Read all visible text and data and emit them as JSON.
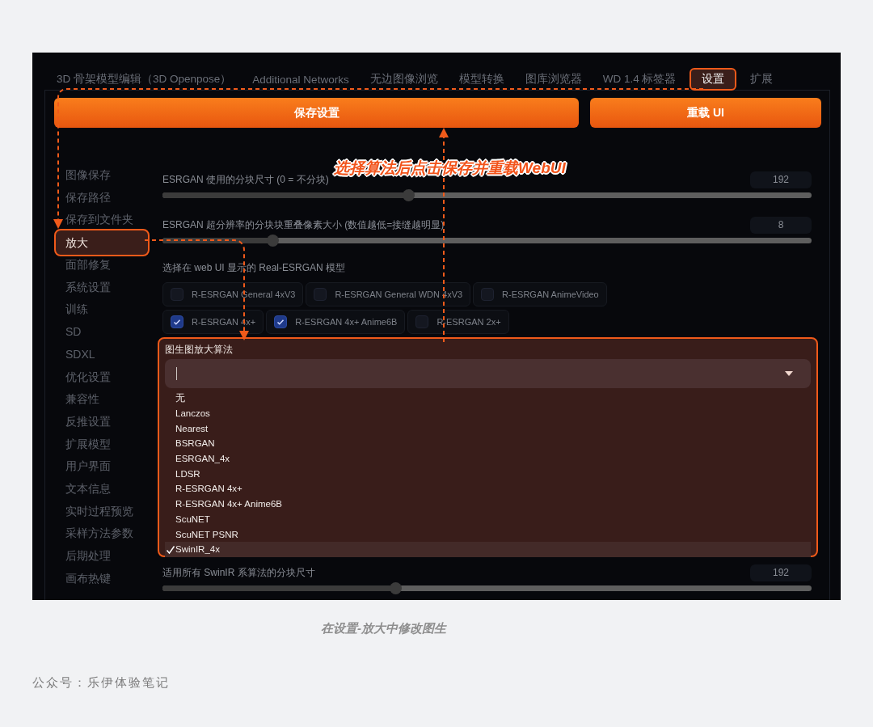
{
  "tabs": [
    {
      "label": "3D 骨架模型编辑（3D Openpose）",
      "selected": false
    },
    {
      "label": "Additional Networks",
      "selected": false
    },
    {
      "label": "无边图像浏览",
      "selected": false
    },
    {
      "label": "模型转换",
      "selected": false
    },
    {
      "label": "图库浏览器",
      "selected": false
    },
    {
      "label": "WD 1.4 标签器",
      "selected": false
    },
    {
      "label": "设置",
      "selected": true
    },
    {
      "label": "扩展",
      "selected": false
    }
  ],
  "buttons": [
    {
      "kind": "save",
      "label": "保存设置"
    },
    {
      "kind": "reload",
      "label": "重载 UI"
    }
  ],
  "sidebar": {
    "items": [
      {
        "label": "图像保存",
        "selected": false
      },
      {
        "label": "保存路径",
        "selected": false
      },
      {
        "label": "保存到文件夹",
        "selected": false
      },
      {
        "label": "放大",
        "selected": true
      },
      {
        "label": "面部修复",
        "selected": false
      },
      {
        "label": "系统设置",
        "selected": false
      },
      {
        "label": "训练",
        "selected": false
      },
      {
        "label": "SD",
        "selected": false
      },
      {
        "label": "SDXL",
        "selected": false
      },
      {
        "label": "优化设置",
        "selected": false
      },
      {
        "label": "兼容性",
        "selected": false
      },
      {
        "label": "反推设置",
        "selected": false
      },
      {
        "label": "扩展模型",
        "selected": false
      },
      {
        "label": "用户界面",
        "selected": false
      },
      {
        "label": "文本信息",
        "selected": false
      },
      {
        "label": "实时过程预览",
        "selected": false
      },
      {
        "label": "采样方法参数",
        "selected": false
      },
      {
        "label": "后期处理",
        "selected": false
      },
      {
        "label": "画布热键",
        "selected": false
      }
    ]
  },
  "annotation": {
    "text": "选择算法后点击保存并重载WebUI"
  },
  "settings": [
    {
      "kind": "slider",
      "label": "ESRGAN 使用的分块尺寸 (0 = 不分块)",
      "value": "192",
      "level": 0.38
    },
    {
      "kind": "slider",
      "label": "ESRGAN 超分辨率的分块块重叠像素大小 (数值越低=接缝越明显)",
      "value": "8",
      "level": 0.17
    },
    {
      "kind": "checkboxes",
      "label": "选择在 web UI 显示的 Real-ESRGAN 模型",
      "options": [
        {
          "label": "R-ESRGAN General 4xV3",
          "checked": false
        },
        {
          "label": "R-ESRGAN General WDN 4xV3",
          "checked": false
        },
        {
          "label": "R-ESRGAN AnimeVideo",
          "checked": false
        },
        {
          "label": "R-ESRGAN 4x+",
          "checked": true
        },
        {
          "label": "R-ESRGAN 4x+ Anime6B",
          "checked": true
        },
        {
          "label": "R-ESRGAN 2x+",
          "checked": false
        }
      ]
    },
    {
      "kind": "dropdown",
      "label": "图生图放大算法",
      "highlighted": true,
      "options": [
        {
          "label": "无",
          "selected": false
        },
        {
          "label": "Lanczos",
          "selected": false
        },
        {
          "label": "Nearest",
          "selected": false
        },
        {
          "label": "BSRGAN",
          "selected": false
        },
        {
          "label": "ESRGAN_4x",
          "selected": false
        },
        {
          "label": "LDSR",
          "selected": false
        },
        {
          "label": "R-ESRGAN 4x+",
          "selected": false
        },
        {
          "label": "R-ESRGAN 4x+ Anime6B",
          "selected": false
        },
        {
          "label": "ScuNET",
          "selected": false
        },
        {
          "label": "ScuNET PSNR",
          "selected": false
        },
        {
          "label": "SwinIR_4x",
          "selected": true
        }
      ]
    },
    {
      "kind": "slider",
      "label": "适用所有 SwinIR 系算法的分块尺寸",
      "value": "192",
      "level": 0.36
    }
  ],
  "caption": "在设置-放大中修改图生",
  "footer": "公众号：乐伊体验笔记"
}
